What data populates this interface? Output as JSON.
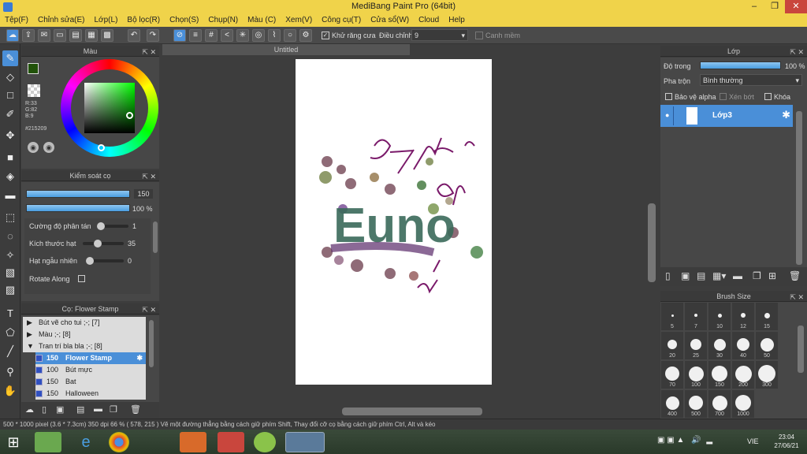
{
  "window": {
    "title": "MediBang Paint Pro (64bit)"
  },
  "menu": [
    "Tệp(F)",
    "Chỉnh sửa(E)",
    "Lớp(L)",
    "Bộ lọc(R)",
    "Chọn(S)",
    "Chụp(N)",
    "Màu (C)",
    "Xem(V)",
    "Công cụ(T)",
    "Cửa sổ(W)",
    "Cloud",
    "Help"
  ],
  "toolbar": {
    "antialias_label": "Khử răng cưa",
    "correction_label": "Điều chỉnh",
    "correction_value": "9",
    "edge_label": "Canh mềm"
  },
  "color_panel": {
    "title": "Màu",
    "r": "R:33",
    "g": "G:82",
    "b": "B:9",
    "hex": "#215209",
    "fg_color": "#215209"
  },
  "brush_control": {
    "title": "Kiểm soát cọ",
    "size_value": "150",
    "opacity_value": "100 %",
    "rows": [
      {
        "label": "Cường độ phân tán",
        "value": "1"
      },
      {
        "label": "Kích thước hạt",
        "value": "35"
      },
      {
        "label": "Hạt ngẫu nhiên",
        "value": "0"
      },
      {
        "label": "Rotate Along",
        "value": ""
      }
    ]
  },
  "brush_list": {
    "title": "Cọ: Flower Stamp",
    "groups": [
      "Bút vẽ cho tui ;-; [7]",
      "Màu ;-; [8]",
      "Tran trí bla bla ;-; [8]"
    ],
    "items": [
      {
        "size": "150",
        "name": "Flower Stamp"
      },
      {
        "size": "100",
        "name": "Bút mực"
      },
      {
        "size": "150",
        "name": "Bat"
      },
      {
        "size": "150",
        "name": "Halloween"
      }
    ]
  },
  "canvas": {
    "tab": "Untitled",
    "drawing_text": "Euno"
  },
  "layer_panel": {
    "title": "Lớp",
    "opacity_label": "Độ trong",
    "opacity_value": "100 %",
    "blend_label": "Pha trộn",
    "blend_value": "Bình thường",
    "protect_alpha": "Bảo vệ alpha",
    "clip": "Xén bớt",
    "lock": "Khóa",
    "layer_name": "Lớp3"
  },
  "brush_size": {
    "title": "Brush Size",
    "sizes": [
      "5",
      "7",
      "10",
      "12",
      "15",
      "20",
      "25",
      "30",
      "40",
      "50",
      "70",
      "100",
      "150",
      "200",
      "300",
      "400",
      "500",
      "700",
      "1000"
    ]
  },
  "status": {
    "text": "500 * 1000 pixel   (3.6 * 7.3cm)   350 dpi   66 %   ( 578, 215 )   Vẽ một đường thẳng bằng cách giữ phím Shift, Thay đổi cỡ cọ bằng cách giữ phím Ctrl, Alt và kéo"
  },
  "taskbar": {
    "lang": "VIE",
    "time": "23:04",
    "date": "27/06/21"
  }
}
